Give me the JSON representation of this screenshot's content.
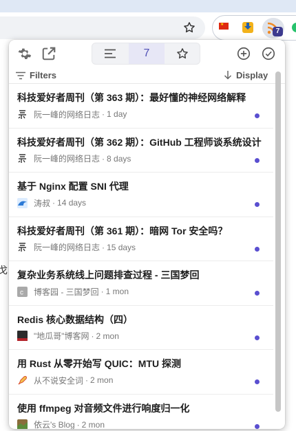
{
  "colors": {
    "accent": "#5a4fd0",
    "badge": "#3d3a8f",
    "chrome_top": "#dfe8f5",
    "omnibox": "#f0f2f5"
  },
  "browser": {
    "extension_badge": "7",
    "extension_icons": [
      "china-flag-icon",
      "download-extension-icon",
      "rss-extension-icon",
      "green-extension-icon"
    ]
  },
  "popup": {
    "toolbar": {
      "settings_icon": "gear-icon",
      "open_tab_icon": "external-link-icon",
      "view_list_icon": "list-icon",
      "unread_count": "7",
      "starred_icon": "star-icon",
      "add_icon": "plus-circle-icon",
      "mark_read_icon": "check-circle-icon"
    },
    "filters_label": "Filters",
    "display_label": "Display",
    "items": [
      {
        "title": "科技爱好者周刊（第 363 期）：最好懂的神经网络解释",
        "source": "阮一峰的网络日志",
        "separator": "·",
        "time": "1 day",
        "favicon": "ruanyifeng-icon",
        "unread": true
      },
      {
        "title": "科技爱好者周刊（第 362 期）：GitHub 工程师谈系统设计",
        "source": "阮一峰的网络日志",
        "separator": "·",
        "time": "8 days",
        "favicon": "ruanyifeng-icon",
        "unread": true
      },
      {
        "title": "基于 Nginx 配置 SNI 代理",
        "source": "涛叔",
        "separator": "·",
        "time": "14 days",
        "favicon": "wave-icon",
        "unread": true
      },
      {
        "title": "科技爱好者周刊（第 361 期）：暗网 Tor 安全吗？",
        "source": "阮一峰的网络日志",
        "separator": "·",
        "time": "15 days",
        "favicon": "ruanyifeng-icon",
        "unread": true
      },
      {
        "title": "复杂业务系统线上问题排查过程 - 三国梦回",
        "source": "博客园 - 三国梦回",
        "separator": "·",
        "time": "1 mon",
        "favicon": "cnblogs-icon",
        "unread": true
      },
      {
        "title": "Redis 核心数据结构（四）",
        "source": "\"地瓜哥\"博客网",
        "separator": "·",
        "time": "2 mon",
        "favicon": "dark-square-icon",
        "unread": true
      },
      {
        "title": "用 Rust 从零开始写 QUIC：MTU 探测",
        "source": "从不说安全词",
        "separator": "·",
        "time": "2 mon",
        "favicon": "rocket-icon",
        "unread": true
      },
      {
        "title": "使用 ffmpeg 对音频文件进行响度归一化",
        "source": "依云's Blog",
        "separator": "·",
        "time": "2 mon",
        "favicon": "photo-icon",
        "unread": true
      }
    ]
  }
}
